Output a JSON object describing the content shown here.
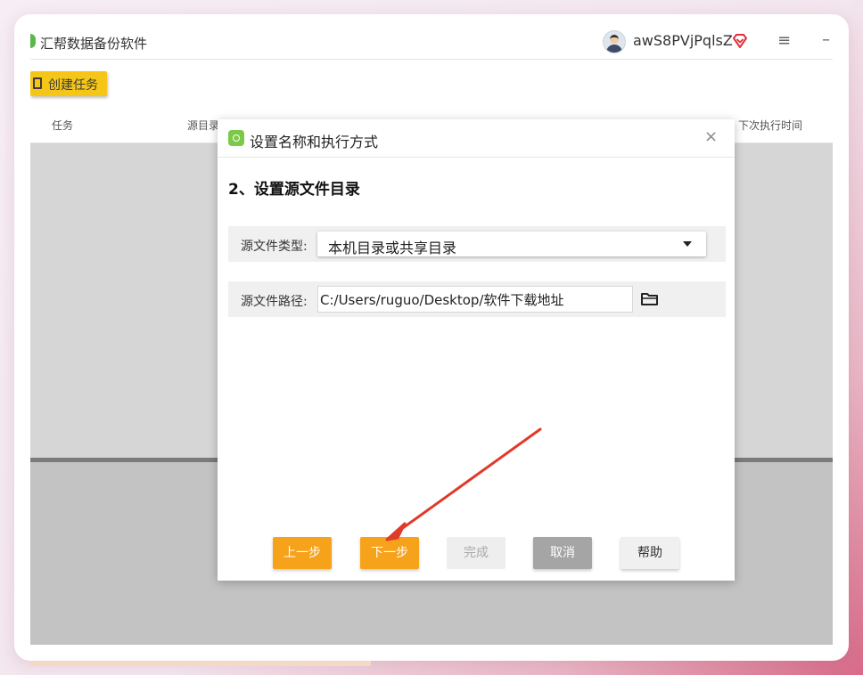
{
  "app": {
    "title": "汇帮数据备份软件",
    "username": "awS8PVjPqlsZ",
    "menu_icon": "≡",
    "minimize_icon": "–",
    "accent_color": "#f7a21b"
  },
  "toolbar": {
    "create_task_label": "创建任务"
  },
  "table": {
    "columns": [
      "任务",
      "源目录",
      "下次执行时间"
    ]
  },
  "dialog": {
    "title": "设置名称和执行方式",
    "close_icon": "×",
    "step_title": "2、设置源文件目录",
    "source_type_label": "源文件类型:",
    "source_type_value": "本机目录或共享目录",
    "source_path_label": "源文件路径:",
    "source_path_value": "C:/Users/ruguo/Desktop/软件下载地址",
    "buttons": {
      "prev": "上一步",
      "next": "下一步",
      "finish": "完成",
      "cancel": "取消",
      "help": "帮助"
    }
  }
}
